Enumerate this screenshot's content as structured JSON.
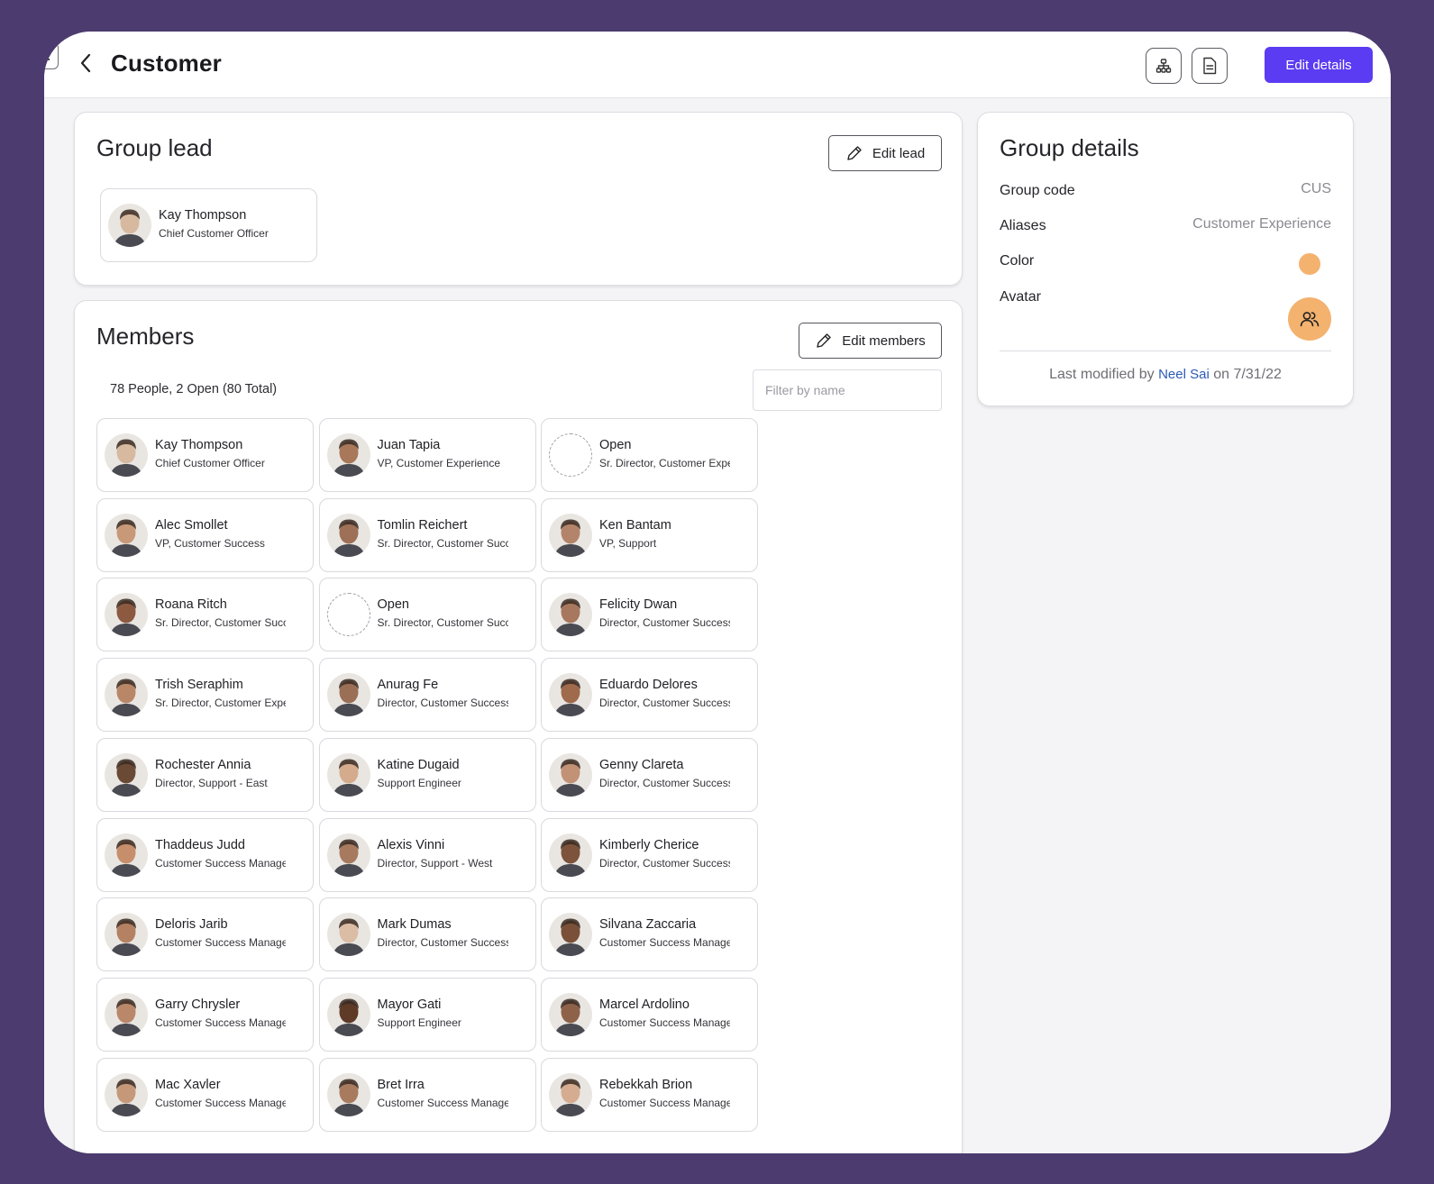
{
  "header": {
    "title": "Customer",
    "edit_details_label": "Edit details",
    "org_chart_icon": "org-chart-icon",
    "document_icon": "document-icon",
    "back_icon": "chevron-left-icon",
    "accent_color": "#5b3cf2"
  },
  "group_lead": {
    "title": "Group lead",
    "edit_label": "Edit lead",
    "lead": {
      "name": "Kay Thompson",
      "title": "Chief Customer Officer",
      "avatar_color": "#d7b9a0"
    }
  },
  "members": {
    "title": "Members",
    "edit_label": "Edit members",
    "count_text": "78 People, 2 Open (80 Total)",
    "filter_placeholder": "Filter by name",
    "people": [
      {
        "name": "Kay Thompson",
        "title": "Chief Customer Officer",
        "open": false,
        "avatar_color": "#d7b9a0"
      },
      {
        "name": "Juan Tapia",
        "title": "VP, Customer Experience",
        "open": false,
        "avatar_color": "#a9775a"
      },
      {
        "name": "Open",
        "title": "Sr. Director, Customer Experience",
        "open": true
      },
      {
        "name": "Alec Smollet",
        "title": "VP, Customer Success",
        "open": false,
        "avatar_color": "#c89979"
      },
      {
        "name": "Tomlin Reichert",
        "title": "Sr. Director, Customer Success",
        "open": false,
        "avatar_color": "#9e7057"
      },
      {
        "name": "Ken Bantam",
        "title": "VP, Support",
        "open": false,
        "avatar_color": "#b3846a"
      },
      {
        "name": "Roana Ritch",
        "title": "Sr. Director, Customer Success",
        "open": false,
        "avatar_color": "#8c5a40"
      },
      {
        "name": "Open",
        "title": "Sr. Director, Customer Success",
        "open": true
      },
      {
        "name": "Felicity Dwan",
        "title": "Director, Customer Success",
        "open": false,
        "avatar_color": "#a7785e"
      },
      {
        "name": "Trish Seraphim",
        "title": "Sr. Director, Customer Experience",
        "open": false,
        "avatar_color": "#b78768"
      },
      {
        "name": "Anurag Fe",
        "title": "Director, Customer Success",
        "open": false,
        "avatar_color": "#9a6f56"
      },
      {
        "name": "Eduardo Delores",
        "title": "Director, Customer Success",
        "open": false,
        "avatar_color": "#a06a4c"
      },
      {
        "name": "Rochester Annia",
        "title": "Director, Support - East",
        "open": false,
        "avatar_color": "#6b4a35"
      },
      {
        "name": "Katine Dugaid",
        "title": "Support Engineer",
        "open": false,
        "avatar_color": "#d4ab8c"
      },
      {
        "name": "Genny Clareta",
        "title": "Director, Customer Success",
        "open": false,
        "avatar_color": "#c19276"
      },
      {
        "name": "Thaddeus Judd",
        "title": "Customer Success Manager",
        "open": false,
        "avatar_color": "#c78e6c"
      },
      {
        "name": "Alexis Vinni",
        "title": "Director, Support - West",
        "open": false,
        "avatar_color": "#a77a60"
      },
      {
        "name": "Kimberly Cherice",
        "title": "Director, Customer Success",
        "open": false,
        "avatar_color": "#7d533c"
      },
      {
        "name": "Deloris Jarib",
        "title": "Customer Success Manager",
        "open": false,
        "avatar_color": "#b48262"
      },
      {
        "name": "Mark Dumas",
        "title": "Director, Customer Success",
        "open": false,
        "avatar_color": "#dbbca5"
      },
      {
        "name": "Silvana Zaccaria",
        "title": "Customer Success Manager",
        "open": false,
        "avatar_color": "#7a5039"
      },
      {
        "name": "Garry Chrysler",
        "title": "Customer Success Manager",
        "open": false,
        "avatar_color": "#b9876a"
      },
      {
        "name": "Mayor Gati",
        "title": "Support Engineer",
        "open": false,
        "avatar_color": "#5e3a27"
      },
      {
        "name": "Marcel Ardolino",
        "title": "Customer Success Manager",
        "open": false,
        "avatar_color": "#8e6249"
      },
      {
        "name": "Mac Xavler",
        "title": "Customer Success Manager",
        "open": false,
        "avatar_color": "#c5987a"
      },
      {
        "name": "Bret Irra",
        "title": "Customer Success Manager",
        "open": false,
        "avatar_color": "#a87b5f"
      },
      {
        "name": "Rebekkah Brion",
        "title": "Customer Success Manager",
        "open": false,
        "avatar_color": "#d5ac90"
      }
    ]
  },
  "group_details": {
    "title": "Group details",
    "rows": {
      "group_code": {
        "label": "Group code",
        "value": "CUS"
      },
      "aliases": {
        "label": "Aliases",
        "value": "Customer Experience"
      },
      "color": {
        "label": "Color",
        "value": "#f4b26f"
      },
      "avatar": {
        "label": "Avatar",
        "icon": "people-icon"
      }
    },
    "modified_prefix": "Last modified by",
    "modified_by": "Neel Sai",
    "modified_suffix": "on 7/31/22"
  }
}
